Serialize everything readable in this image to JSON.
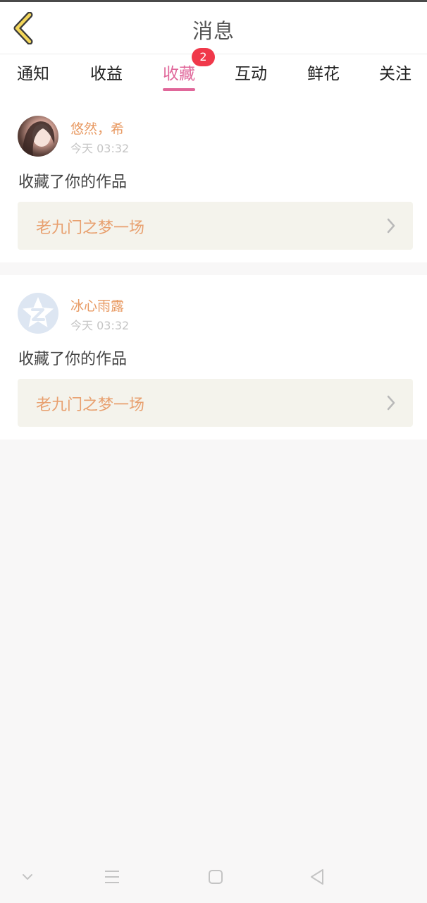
{
  "header": {
    "title": "消息"
  },
  "tabs": [
    {
      "label": "通知"
    },
    {
      "label": "收益"
    },
    {
      "label": "收藏",
      "badge": "2"
    },
    {
      "label": "互动"
    },
    {
      "label": "鲜花"
    },
    {
      "label": "关注"
    }
  ],
  "active_tab": "收藏",
  "messages": [
    {
      "username": "悠然，希",
      "time": "今天 03:32",
      "action": "收藏了你的作品",
      "work_title": "老九门之梦一场",
      "avatar": "user-photo"
    },
    {
      "username": "冰心雨露",
      "time": "今天 03:32",
      "action": "收藏了你的作品",
      "work_title": "老九门之梦一场",
      "avatar": "qzone-default"
    }
  ],
  "colors": {
    "accent": "#e0679a",
    "badge": "#f0384a",
    "username": "#e89a63",
    "work_title": "#e8a06f",
    "back_icon": "#f3d65a"
  }
}
